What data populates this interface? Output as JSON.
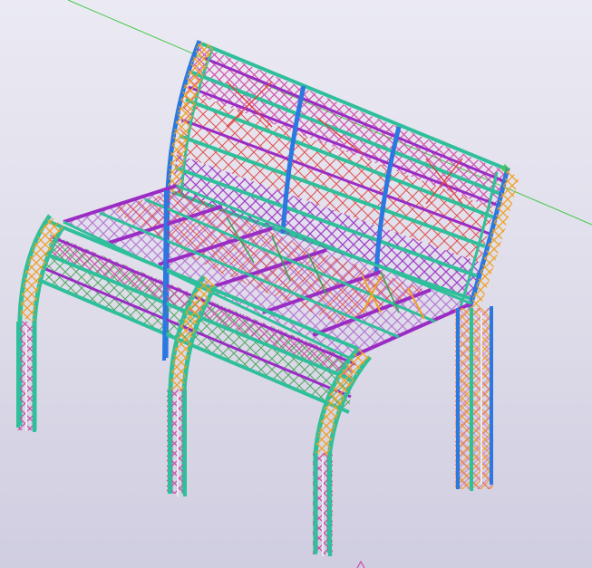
{
  "viewport": {
    "background_top": "#ebeaf3",
    "background_bottom": "#cfcde0",
    "work_axis_color": "#45c84a"
  },
  "model": {
    "description_type": "3D steel truss structure (curved bench-like frame)",
    "colors": {
      "primary_blue": "#2a78e0",
      "teal_chord": "#2fbf9a",
      "purple_brace": "#9a2cc4",
      "magenta_brace": "#d04aa8",
      "red_diagonal": "#e0403a",
      "orange_lacing": "#f0a020",
      "green_lacing": "#3fa050",
      "white_column": "#eaeaf2"
    },
    "components": [
      "rear-arched-backrest-truss",
      "front-arched-seat-truss",
      "seat-platform-grid",
      "front-left-column",
      "front-middle-column",
      "front-right-column",
      "rear-right-column"
    ]
  }
}
